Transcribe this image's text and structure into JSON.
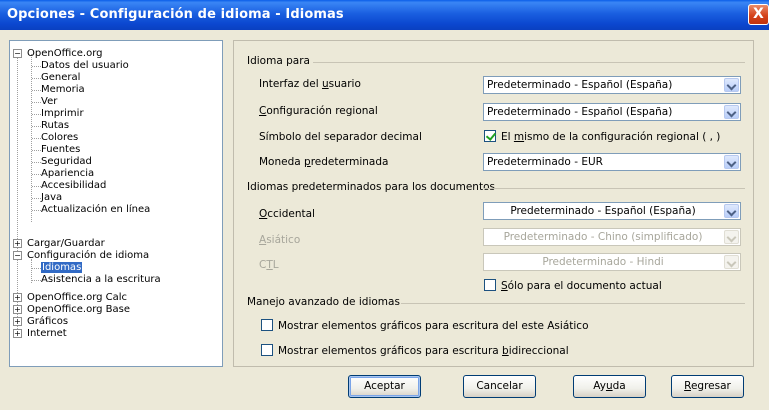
{
  "window": {
    "title": "Opciones - Configuración de idioma - Idiomas",
    "close_glyph": "X"
  },
  "tree": {
    "openoffice": "OpenOffice.org",
    "oo_children": [
      "Datos del usuario",
      "General",
      "Memoria",
      "Ver",
      "Imprimir",
      "Rutas",
      "Colores",
      "Fuentes",
      "Seguridad",
      "Apariencia",
      "Accesibilidad",
      "Java",
      "Actualización en línea"
    ],
    "cargar": "Cargar/Guardar",
    "config_idioma": "Configuración de idioma",
    "idiomas": "Idiomas",
    "asistencia": "Asistencia a la escritura",
    "calc": "OpenOffice.org Calc",
    "base": "OpenOffice.org Base",
    "graficos": "Gráficos",
    "internet": "Internet",
    "plus": "+",
    "minus": "−"
  },
  "idioma_para": {
    "heading": "Idioma para",
    "interfaz_label_pre": "Interfaz del ",
    "interfaz_label_u": "u",
    "interfaz_label_post": "suario",
    "interfaz_value": "Predeterminado - Español (España)",
    "regional_label_u": "C",
    "regional_label_post": "onfiguración regional",
    "regional_value": "Predeterminado - Español (España)",
    "decimal_label": "Símbolo del separador decimal",
    "decimal_check_pre": "El ",
    "decimal_check_u": "m",
    "decimal_check_post": "ismo de la configuración regional ( , )",
    "decimal_checked": true,
    "moneda_label_pre": "Moneda ",
    "moneda_label_u": "p",
    "moneda_label_post": "redeterminada",
    "moneda_value": "Predeterminado - EUR"
  },
  "doc_langs": {
    "heading": "Idiomas predeterminados para los documentos",
    "occidental_label_u": "O",
    "occidental_label_post": "ccidental",
    "occidental_value": "Predeterminado - Español (España)",
    "asiatico_label_u": "A",
    "asiatico_label_post": "siático",
    "asiatico_value": "Predeterminado - Chino (simplificado)",
    "ctl_label_pre": "C",
    "ctl_label_u": "T",
    "ctl_label_post": "L",
    "ctl_value": "Predeterminado - Hindi",
    "solo_u": "S",
    "solo_post": "ólo para el documento actual",
    "solo_checked": false
  },
  "advanced": {
    "heading": "Manejo avanzado de idiomas",
    "asian_label": "Mostrar elementos gráficos para escritura del este Asiático",
    "asian_checked": false,
    "bidi_pre": "Mostrar elementos gráficos para escritura ",
    "bidi_u": "b",
    "bidi_post": "idireccional",
    "bidi_checked": false
  },
  "buttons": {
    "aceptar": "Aceptar",
    "cancelar": "Cancelar",
    "ayuda_pre": "Ay",
    "ayuda_u": "u",
    "ayuda_post": "da",
    "regresar_u": "R",
    "regresar_post": "egresar"
  }
}
